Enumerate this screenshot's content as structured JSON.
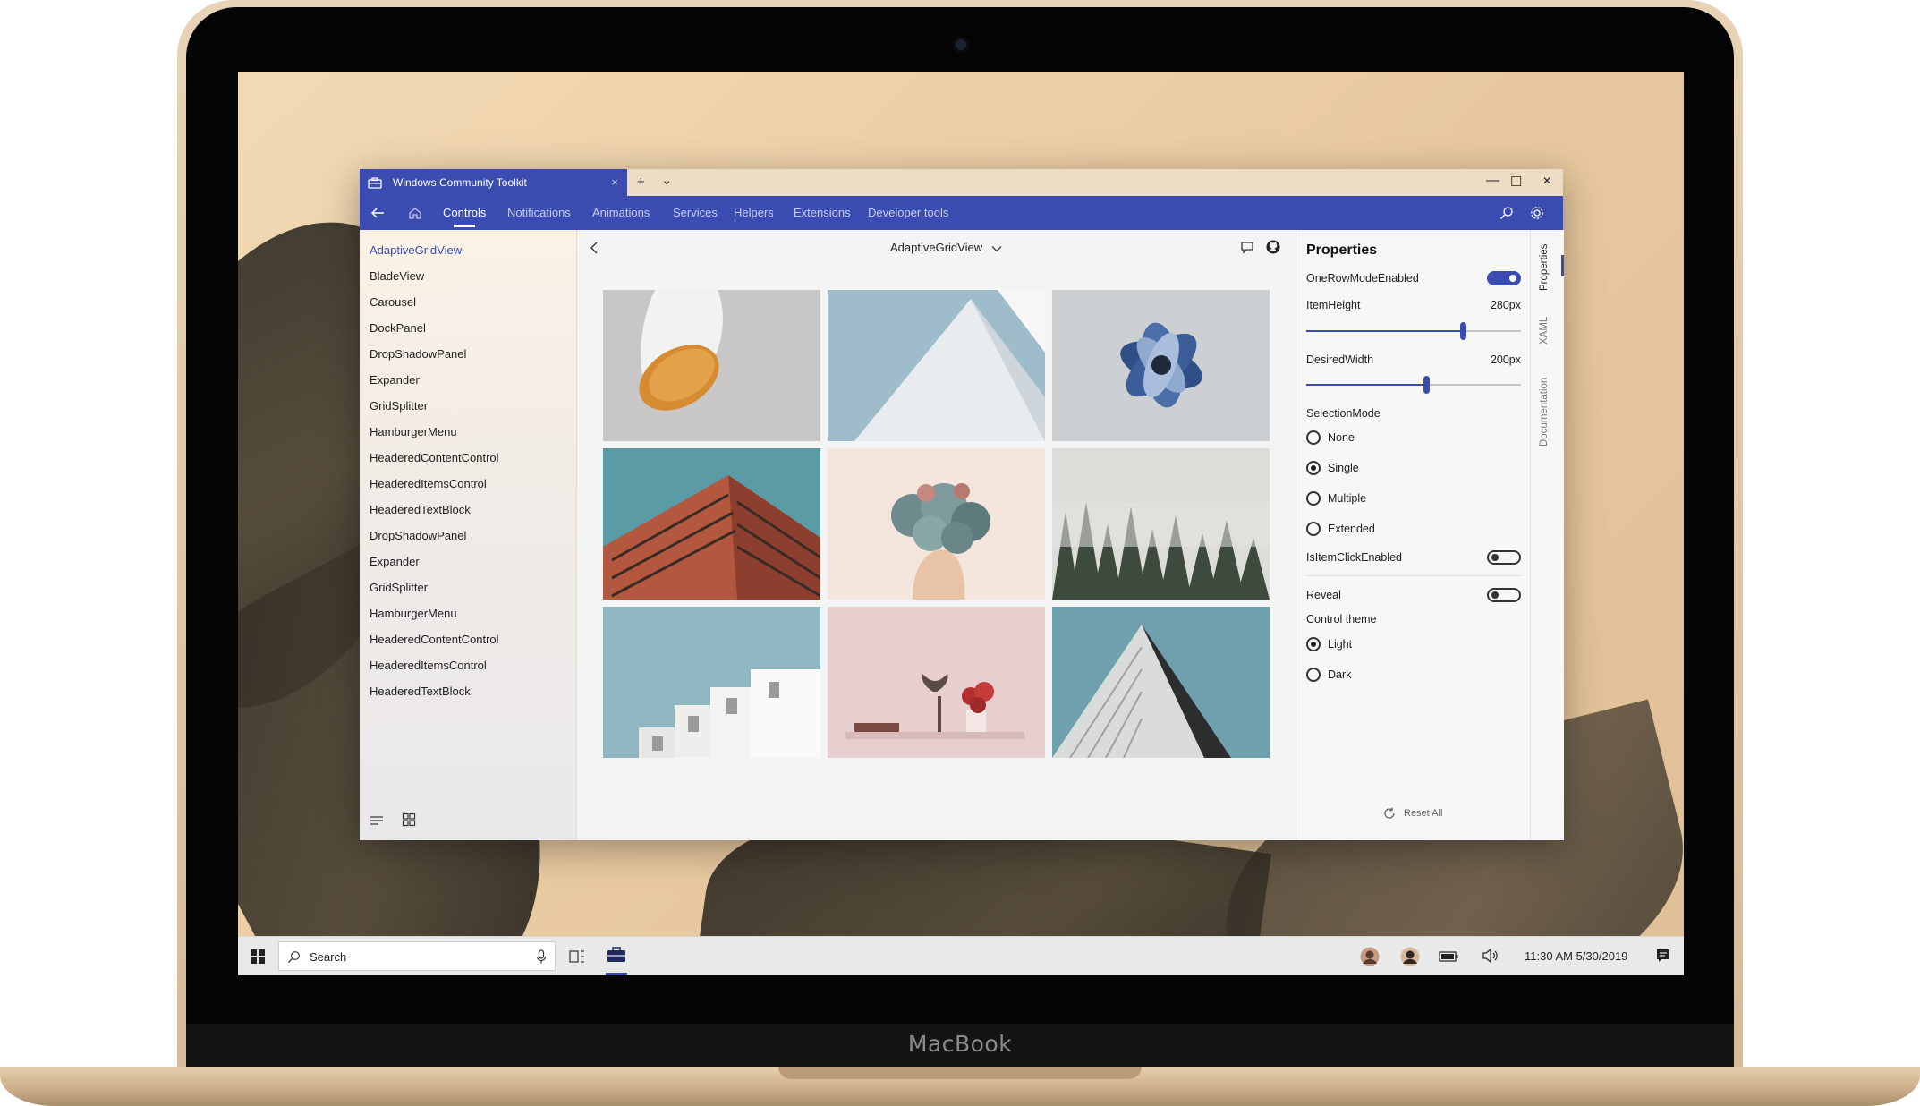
{
  "window": {
    "tab_title": "Windows Community Toolkit",
    "tab_close": "×",
    "new_tab": "+",
    "tab_menu": "⌄",
    "minimize": "—",
    "maximize": "☐",
    "close": "✕"
  },
  "nav": {
    "items": [
      "Controls",
      "Notifications",
      "Animations",
      "Services",
      "Helpers",
      "Extensions",
      "Developer tools"
    ],
    "active": "Controls"
  },
  "sidebar": {
    "items": [
      "AdaptiveGridView",
      "BladeView",
      "Carousel",
      "DockPanel",
      "DropShadowPanel",
      "Expander",
      "GridSplitter",
      "HamburgerMenu",
      "HeaderedContentControl",
      "HeaderedItemsControl",
      "HeaderedTextBlock",
      "DropShadowPanel",
      "Expander",
      "GridSplitter",
      "HamburgerMenu",
      "HeaderedContentControl",
      "HeaderedItemsControl",
      "HeaderedTextBlock"
    ],
    "selected_index": 0
  },
  "content": {
    "title": "AdaptiveGridView",
    "images": [
      "lamp",
      "pyramid-roof",
      "blue-flower",
      "brick-building",
      "succulent-head",
      "foggy-forest",
      "white-building",
      "pink-shelf",
      "triangle-building"
    ]
  },
  "properties": {
    "title": "Properties",
    "one_row_mode_label": "OneRowModeEnabled",
    "one_row_mode_on": true,
    "item_height_label": "ItemHeight",
    "item_height_value": "280px",
    "item_height_fraction": 0.73,
    "desired_width_label": "DesiredWidth",
    "desired_width_value": "200px",
    "desired_width_fraction": 0.56,
    "selection_mode_label": "SelectionMode",
    "selection_modes": [
      "None",
      "Single",
      "Multiple",
      "Extended"
    ],
    "selection_mode_selected": "Single",
    "is_item_click_label": "IsItemClickEnabled",
    "is_item_click_on": false,
    "reveal_label": "Reveal",
    "reveal_on": false,
    "control_theme_label": "Control theme",
    "themes": [
      "Light",
      "Dark"
    ],
    "theme_selected": "Light",
    "reset_label": "Reset All"
  },
  "side_tabs": [
    "Properties",
    "XAML",
    "Documentation"
  ],
  "taskbar": {
    "search_placeholder": "Search",
    "clock": "11:30 AM 5/30/2019"
  },
  "device": {
    "brand": "MacBook"
  },
  "colors": {
    "accent": "#3a4caf",
    "titlebar": "#ecdcc4"
  }
}
